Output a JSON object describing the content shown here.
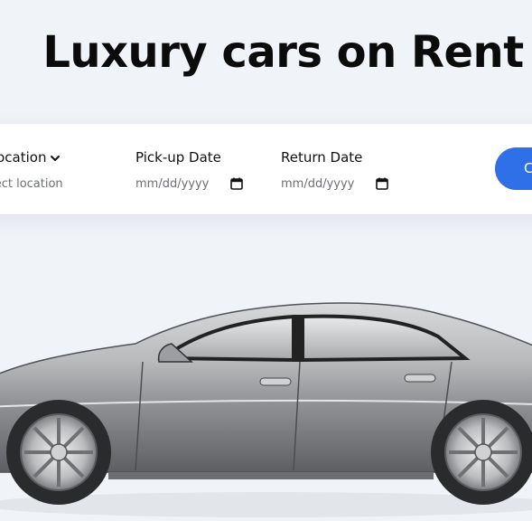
{
  "hero": {
    "title": "Luxury cars on Rent"
  },
  "search": {
    "location_label": "Pick-up Location",
    "location_placeholder": "Please select location",
    "pickup_label": "Pick-up Date",
    "pickup_placeholder": "mm/dd/yyyy",
    "return_label": "Return Date",
    "return_placeholder": "mm/dd/yyyy",
    "button_label": "C"
  },
  "icons": {
    "chevron": "chevron-down-icon",
    "calendar": "calendar-icon"
  },
  "colors": {
    "page_background": "#f0f3f8",
    "accent": "#2f6fe7",
    "car_body": "#a9abad"
  }
}
